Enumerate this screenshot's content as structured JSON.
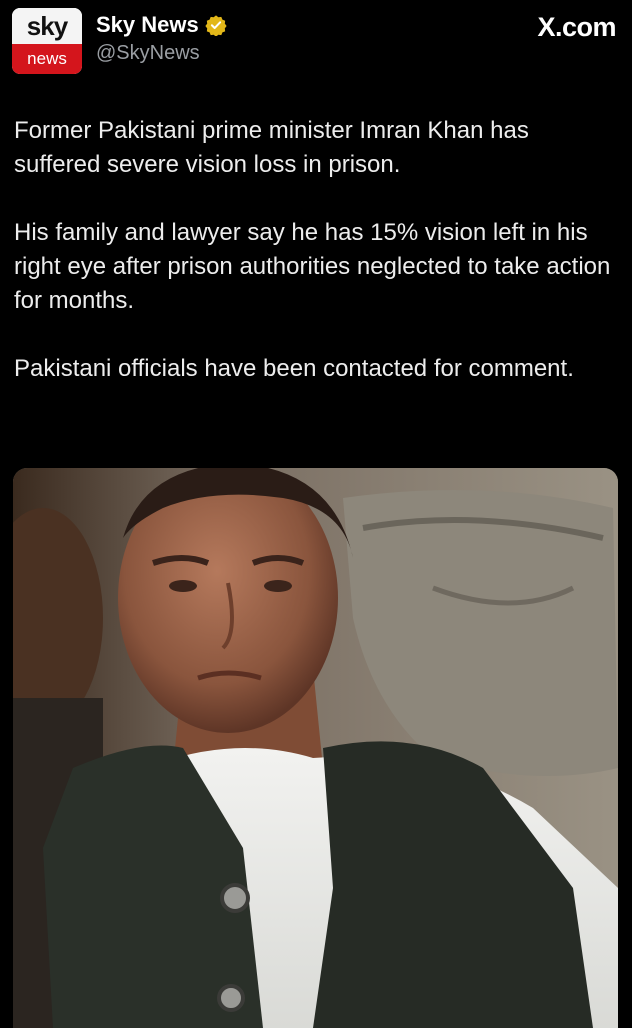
{
  "account": {
    "avatar_top": "sky",
    "avatar_bottom": "news",
    "name": "Sky News",
    "handle": "@SkyNews",
    "verified_icon": "gold-verified-badge-icon"
  },
  "source_label": "X.com",
  "tweet": {
    "paragraphs": [
      "Former Pakistani prime minister Imran Khan has suffered severe vision loss in prison.",
      "His family and lawyer say he has 15% vision left in his right eye after prison authorities neglected to take action for months.",
      "Pakistani officials have been contacted for comment."
    ]
  },
  "colors": {
    "background": "#000000",
    "brand_red": "#d4151c",
    "verified_gold": "#e2b719"
  }
}
